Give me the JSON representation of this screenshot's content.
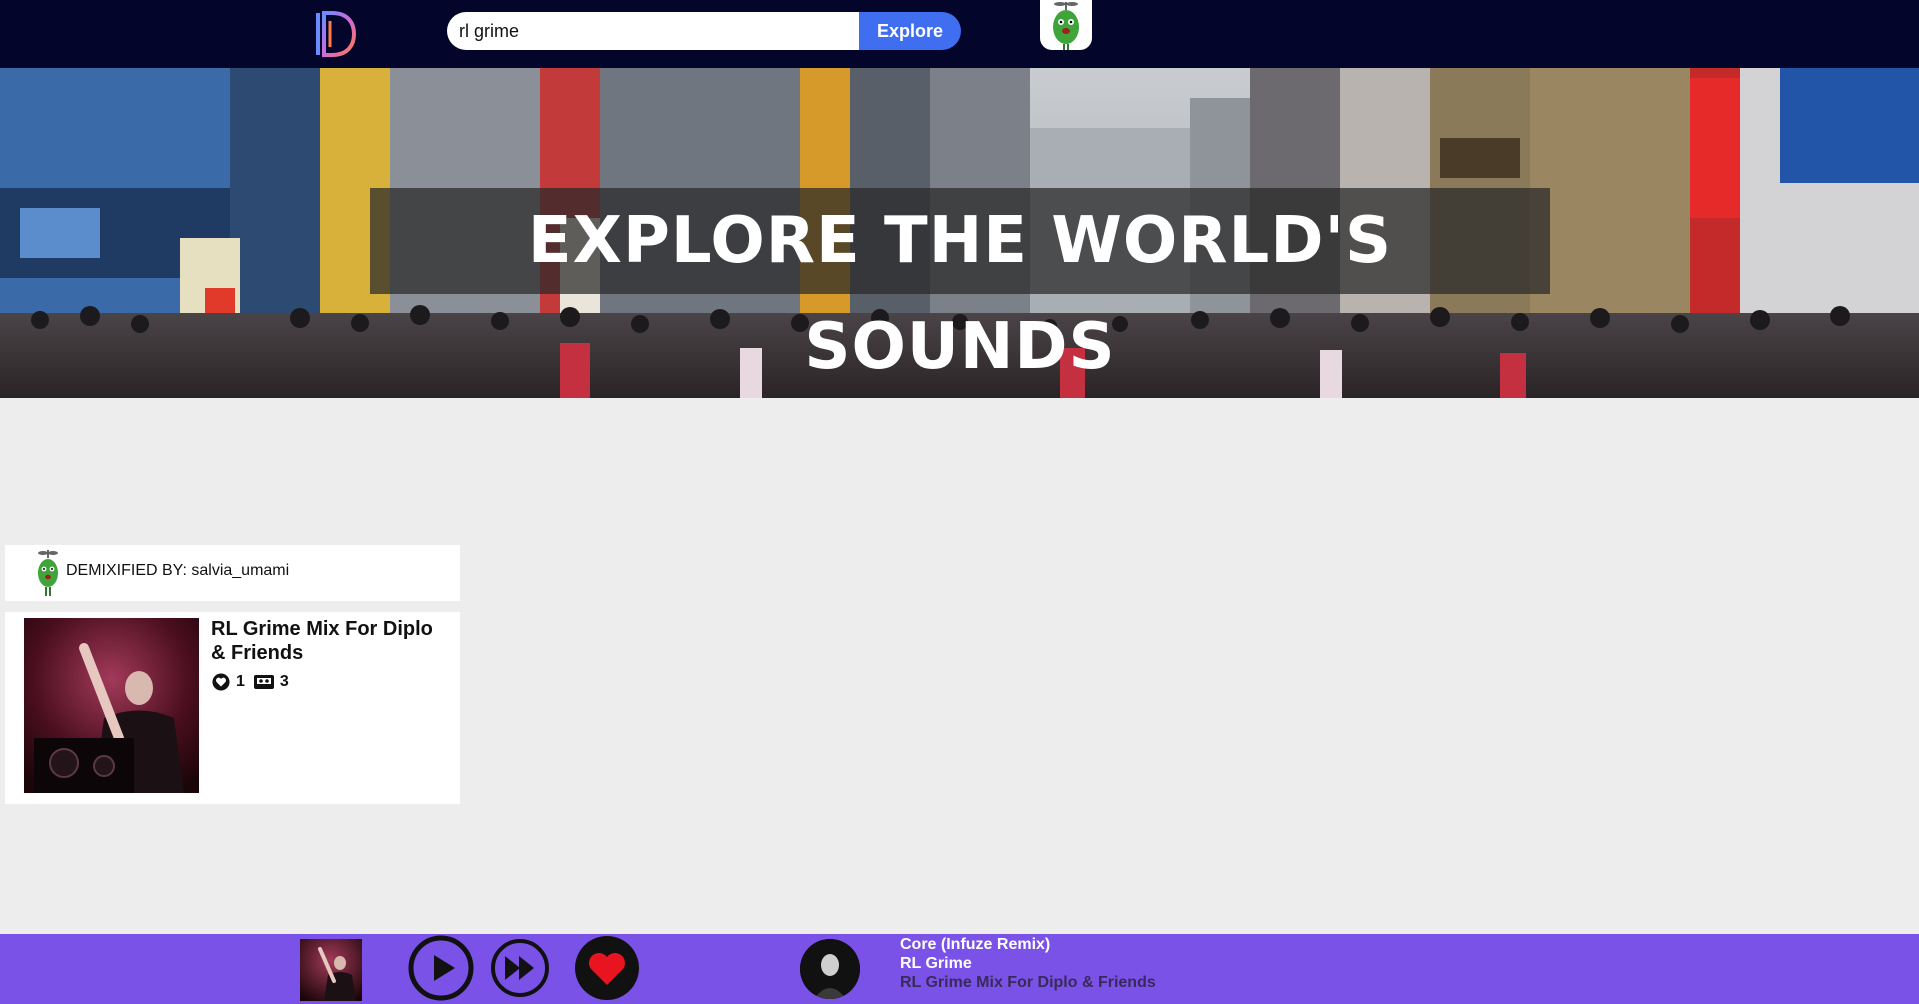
{
  "nav": {
    "logo_icon": "demixify-d-logo",
    "search": {
      "value": "rl grime",
      "placeholder": ""
    },
    "explore_label": "Explore",
    "user_avatar_icon": "green-pickle-avatar"
  },
  "hero": {
    "title": "EXPLORE THE WORLD'S SOUNDS",
    "background": "tokyo-street-photo"
  },
  "user_card": {
    "label": "DEMIXIFIED BY: salvia_umami",
    "avatar_icon": "green-pickle-avatar"
  },
  "mix_card": {
    "title": "RL Grime Mix For Diplo & Friends",
    "likes": "1",
    "tracks": "3",
    "like_icon": "heart-circle-icon",
    "track_icon": "cassette-icon"
  },
  "player": {
    "track": "Core (Infuze Remix)",
    "artist": "RL Grime",
    "mix": "RL Grime Mix For Diplo & Friends",
    "icons": {
      "play": "play-icon",
      "next": "fast-forward-icon",
      "favorite": "heart-icon"
    }
  },
  "colors": {
    "nav_bg": "#04052a",
    "explore_btn": "#3f6ef0",
    "player_bg": "#7a52e8",
    "favorite": "#e8141f",
    "page_bg": "#ededed"
  }
}
